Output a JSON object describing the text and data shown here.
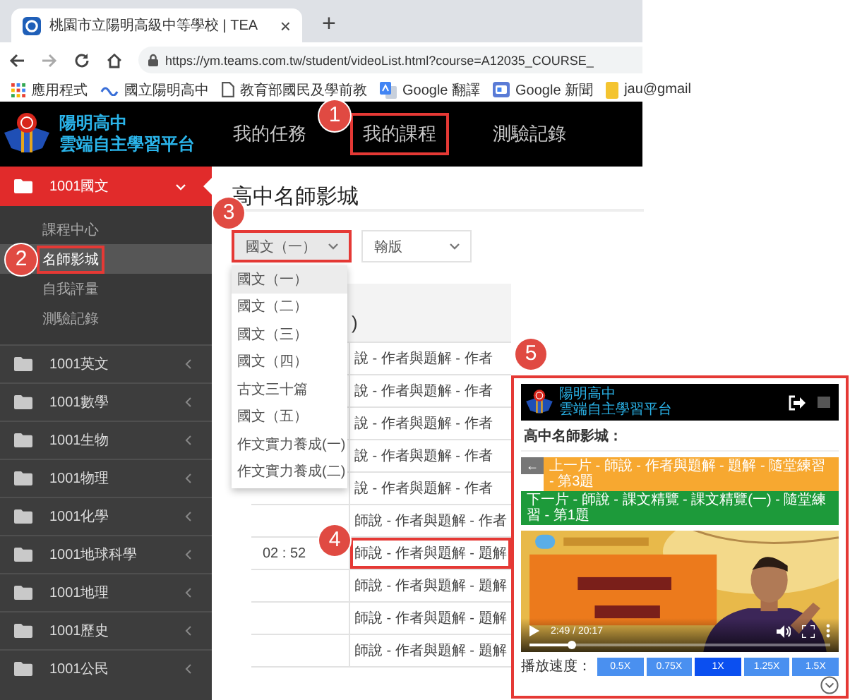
{
  "browser": {
    "tab": {
      "title": "桃園市立陽明高級中等學校 | TEA",
      "close": "×"
    },
    "new_tab": "+",
    "url": "https://ym.teams.com.tw/student/videoList.html?course=A12035_COURSE_",
    "bookmarks": [
      {
        "kind": "apps",
        "label": "應用程式"
      },
      {
        "kind": "site",
        "label": "國立陽明高中"
      },
      {
        "kind": "page",
        "label": "教育部國民及學前教"
      },
      {
        "kind": "translate",
        "label": "Google 翻譯"
      },
      {
        "kind": "news",
        "label": "Google 新聞"
      },
      {
        "kind": "note",
        "label": "jau@gmail"
      }
    ]
  },
  "site": {
    "brand": [
      "陽明高中",
      "雲端自主學習平台"
    ],
    "nav": [
      {
        "label": "我的任務"
      },
      {
        "label": "我的課程",
        "callout": "1"
      },
      {
        "label": "測驗記錄"
      }
    ]
  },
  "sidebar": {
    "courses": [
      {
        "label": "1001國文",
        "expanded": true,
        "children": [
          {
            "label": "課程中心",
            "selected": false
          },
          {
            "label": "名師影城",
            "selected": true,
            "callout": "2"
          },
          {
            "label": "自我評量",
            "selected": false
          },
          {
            "label": "測驗記錄",
            "selected": false
          }
        ]
      },
      {
        "label": "1001英文",
        "expanded": false
      },
      {
        "label": "1001數學",
        "expanded": false
      },
      {
        "label": "1001生物",
        "expanded": false
      },
      {
        "label": "1001物理",
        "expanded": false
      },
      {
        "label": "1001化學",
        "expanded": false
      },
      {
        "label": "1001地球科學",
        "expanded": false
      },
      {
        "label": "1001地理",
        "expanded": false
      },
      {
        "label": "1001歷史",
        "expanded": false
      },
      {
        "label": "1001公民",
        "expanded": false
      }
    ]
  },
  "main": {
    "title": "高中名師影城",
    "filters": [
      {
        "value": "國文（一）",
        "expanded": true,
        "callout": "3",
        "options": [
          {
            "label": "國文（一）",
            "selected": true
          },
          {
            "label": "國文（二）",
            "selected": false
          },
          {
            "label": "國文（三）",
            "selected": false
          },
          {
            "label": "國文（四）",
            "selected": false
          },
          {
            "label": "古文三十篇",
            "selected": false
          },
          {
            "label": "國文（五）",
            "selected": false
          },
          {
            "label": "作文實力養成(一)",
            "selected": false
          },
          {
            "label": "作文實力養成(二)",
            "selected": false
          }
        ]
      },
      {
        "value": "翰版",
        "expanded": false
      }
    ],
    "table": {
      "heading": ")",
      "rows": [
        {
          "title": "說 - 作者與題解 - 作者"
        },
        {
          "title": "說 - 作者與題解 - 作者"
        },
        {
          "title": "說 - 作者與題解 - 作者"
        },
        {
          "title": "說 - 作者與題解 - 作者"
        },
        {
          "title": "說 - 作者與題解 - 作者"
        },
        {
          "title": "師說 - 作者與題解 - 作者"
        },
        {
          "time": "02 : 52",
          "title": "師說 - 作者與題解 - 題解",
          "callout": "4"
        },
        {
          "title": "師說 - 作者與題解 - 題解"
        },
        {
          "title": "師說 - 作者與題解 - 題解"
        },
        {
          "title": "師說 - 作者與題解 - 題解"
        }
      ]
    }
  },
  "preview": {
    "callout": "5",
    "brand": [
      "陽明高中",
      "雲端自主學習平台"
    ],
    "title": "高中名師影城：",
    "back": "←",
    "prev": "上一片 - 師說 - 作者與題解 - 題解 - 隨堂練習 - 第3題",
    "next": "下一片 - 師說 - 課文精覽 - 課文精覽(一) - 隨堂練習 - 第1題",
    "video": {
      "kind": "picture",
      "time": "2:49 / 20:17",
      "level": 0.14
    },
    "speed_label": "播放速度：",
    "speeds": [
      {
        "label": "0.5X",
        "selected": false
      },
      {
        "label": "0.75X",
        "selected": false
      },
      {
        "label": "1X",
        "selected": true
      },
      {
        "label": "1.25X",
        "selected": false
      },
      {
        "label": "1.5X",
        "selected": false
      }
    ]
  }
}
